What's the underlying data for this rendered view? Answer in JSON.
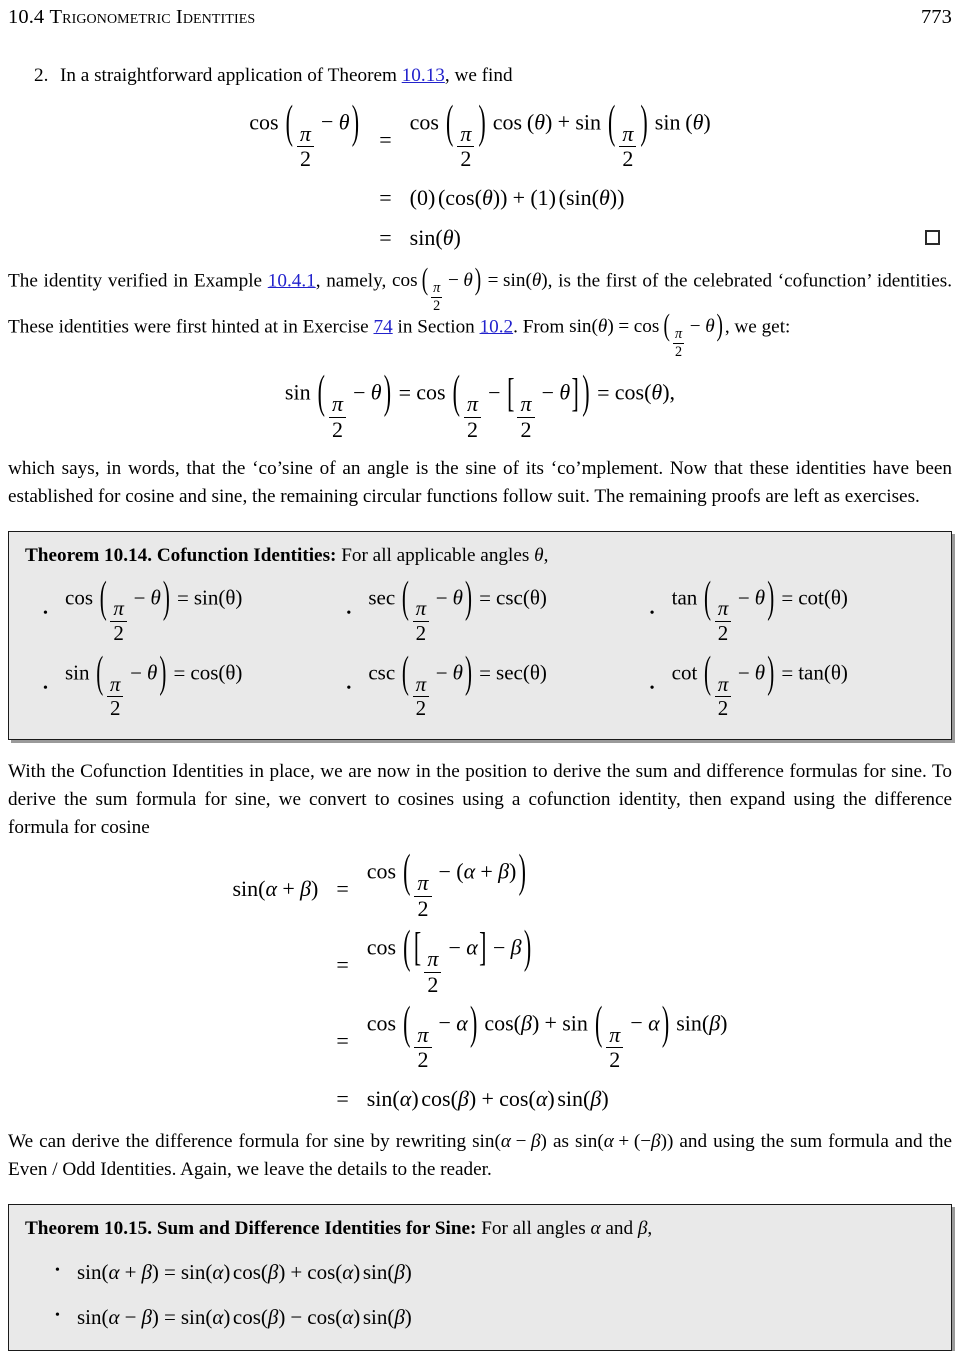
{
  "header": {
    "section_number": "10.4",
    "section_title": "Trigonometric Identities",
    "page_number": "773"
  },
  "item2": {
    "number": "2.",
    "text_before_link": "In a straightforward application of Theorem ",
    "link": "10.13",
    "text_after_link": ", we find"
  },
  "equation_block_1": {
    "rows": [
      {
        "lhs": "cos ( π/2 − θ )",
        "relation": "=",
        "rhs": "cos ( π/2 ) cos (θ) + sin ( π/2 ) sin (θ)"
      },
      {
        "lhs": "",
        "relation": "=",
        "rhs": "(0) (cos(θ)) + (1) (sin(θ))"
      },
      {
        "lhs": "",
        "relation": "=",
        "rhs": "sin(θ)"
      }
    ],
    "qed_symbol": "open-square"
  },
  "paragraph_1": {
    "s1": "The identity verified in Example ",
    "link1": "10.4.1",
    "s2": ", namely, ",
    "math1": "cos ( π/2 − θ ) = sin(θ)",
    "s3": ", is the first of the celebrated ‘cofunction’ identities. These identities were first hinted at in Exercise ",
    "link2": "74",
    "s4": " in Section ",
    "link3": "10.2",
    "s5": ". From ",
    "math2": "sin(θ) = cos ( π/2 − θ )",
    "s6": ", we get:"
  },
  "equation_block_2": {
    "content": "sin ( π/2 − θ ) = cos ( π/2 − [ π/2 − θ ] ) = cos(θ),"
  },
  "paragraph_2": {
    "text": "which says, in words, that the ‘co’sine of an angle is the sine of its ‘co’mplement. Now that these identities have been established for cosine and sine, the remaining circular functions follow suit. The remaining proofs are left as exercises."
  },
  "theorem_10_14": {
    "label": "Theorem 10.14.",
    "name": "Cofunction Identities:",
    "lead": "For all applicable angles ",
    "lead_var": "θ",
    "lead_end": ",",
    "bullet": "•",
    "identities": [
      {
        "fn": "cos",
        "result": "sin(θ)"
      },
      {
        "fn": "sec",
        "result": "csc(θ)"
      },
      {
        "fn": "tan",
        "result": "cot(θ)"
      },
      {
        "fn": "sin",
        "result": "cos(θ)"
      },
      {
        "fn": "csc",
        "result": "sec(θ)"
      },
      {
        "fn": "cot",
        "result": "tan(θ)"
      }
    ]
  },
  "paragraph_3": {
    "text": "With the Cofunction Identities in place, we are now in the position to derive the sum and difference formulas for sine.  To derive the sum formula for sine, we convert to cosines using a cofunction identity, then expand using the difference formula for cosine"
  },
  "equation_block_3": {
    "rows": [
      {
        "lhs": "sin(α + β)",
        "relation": "=",
        "rhs": "cos ( π/2 − (α + β) )"
      },
      {
        "lhs": "",
        "relation": "=",
        "rhs": "cos ( [ π/2 − α ] − β )"
      },
      {
        "lhs": "",
        "relation": "=",
        "rhs": "cos ( π/2 − α ) cos(β) + sin ( π/2 − α ) sin(β)"
      },
      {
        "lhs": "",
        "relation": "=",
        "rhs": "sin(α) cos(β) + cos(α) sin(β)"
      }
    ]
  },
  "paragraph_4": {
    "s1": "We can derive the difference formula for sine by rewriting ",
    "m1": "sin(α − β)",
    "s2": " as ",
    "m2": "sin(α + (−β))",
    "s3": " and using the sum formula and the Even / Odd Identities. Again, we leave the details to the reader."
  },
  "theorem_10_15": {
    "label": "Theorem 10.15.",
    "name": "Sum and Difference Identities for Sine:",
    "lead": "For all angles ",
    "lead_var1": "α",
    "lead_and": " and ",
    "lead_var2": "β",
    "lead_end": ",",
    "bullet": "•",
    "identities": [
      {
        "sign_lhs": "+",
        "sign_rhs": "+"
      },
      {
        "sign_lhs": "−",
        "sign_rhs": "−"
      }
    ]
  },
  "symbols": {
    "pi": "π",
    "theta": "θ",
    "alpha": "α",
    "beta": "β",
    "minus": "−",
    "plus": "+",
    "equals": "=",
    "two": "2",
    "paren_left": "(",
    "paren_right": ")",
    "bracket_left": "[",
    "bracket_right": "]"
  },
  "colors": {
    "link": "#2222cc",
    "box_fill": "#e9e9e9",
    "box_border": "#1a1a1a",
    "box_shadow": "#9a9a9a",
    "text": "#000000"
  }
}
